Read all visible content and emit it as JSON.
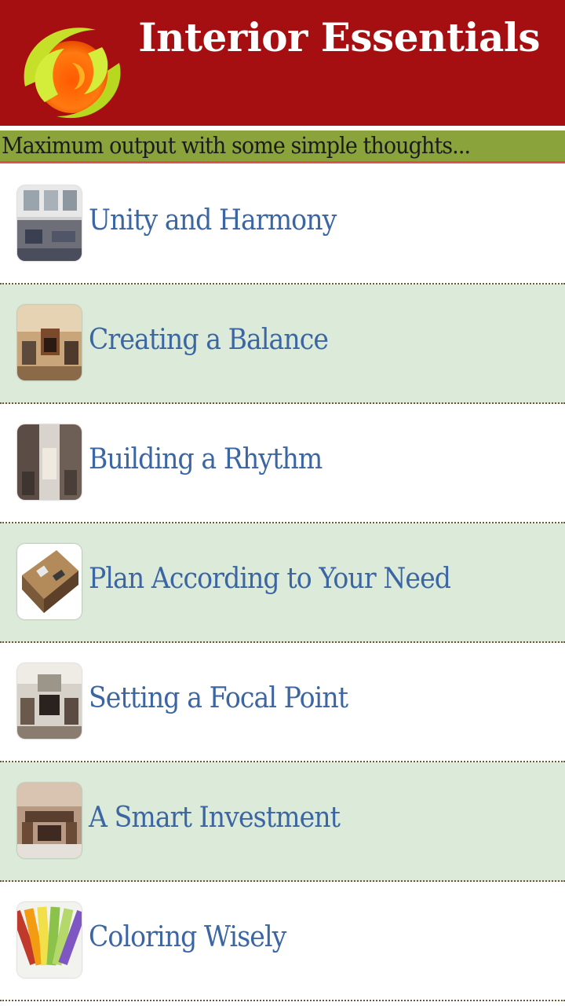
{
  "header": {
    "title": "Interior Essentials",
    "logo_icon": "swirl-logo-icon",
    "background_color": "#a50f11"
  },
  "tagline": {
    "text": "Maximum output with some simple thoughts...",
    "background_color": "#8aa33b"
  },
  "list": {
    "items": [
      {
        "label": "Unity and Harmony",
        "thumbnail_icon": "living-room-photo-icon"
      },
      {
        "label": "Creating a Balance",
        "thumbnail_icon": "fireplace-room-photo-icon"
      },
      {
        "label": "Building a Rhythm",
        "thumbnail_icon": "hallway-photo-icon"
      },
      {
        "label": "Plan According to Your Need",
        "thumbnail_icon": "floor-plan-photo-icon"
      },
      {
        "label": "Setting a Focal Point",
        "thumbnail_icon": "focal-fireplace-photo-icon"
      },
      {
        "label": "A Smart Investment",
        "thumbnail_icon": "dining-room-photo-icon"
      },
      {
        "label": "Coloring Wisely",
        "thumbnail_icon": "color-swatches-photo-icon"
      }
    ],
    "row_colors": [
      "#ffffff",
      "#dcebd9"
    ],
    "label_color": "#3b66a3"
  }
}
